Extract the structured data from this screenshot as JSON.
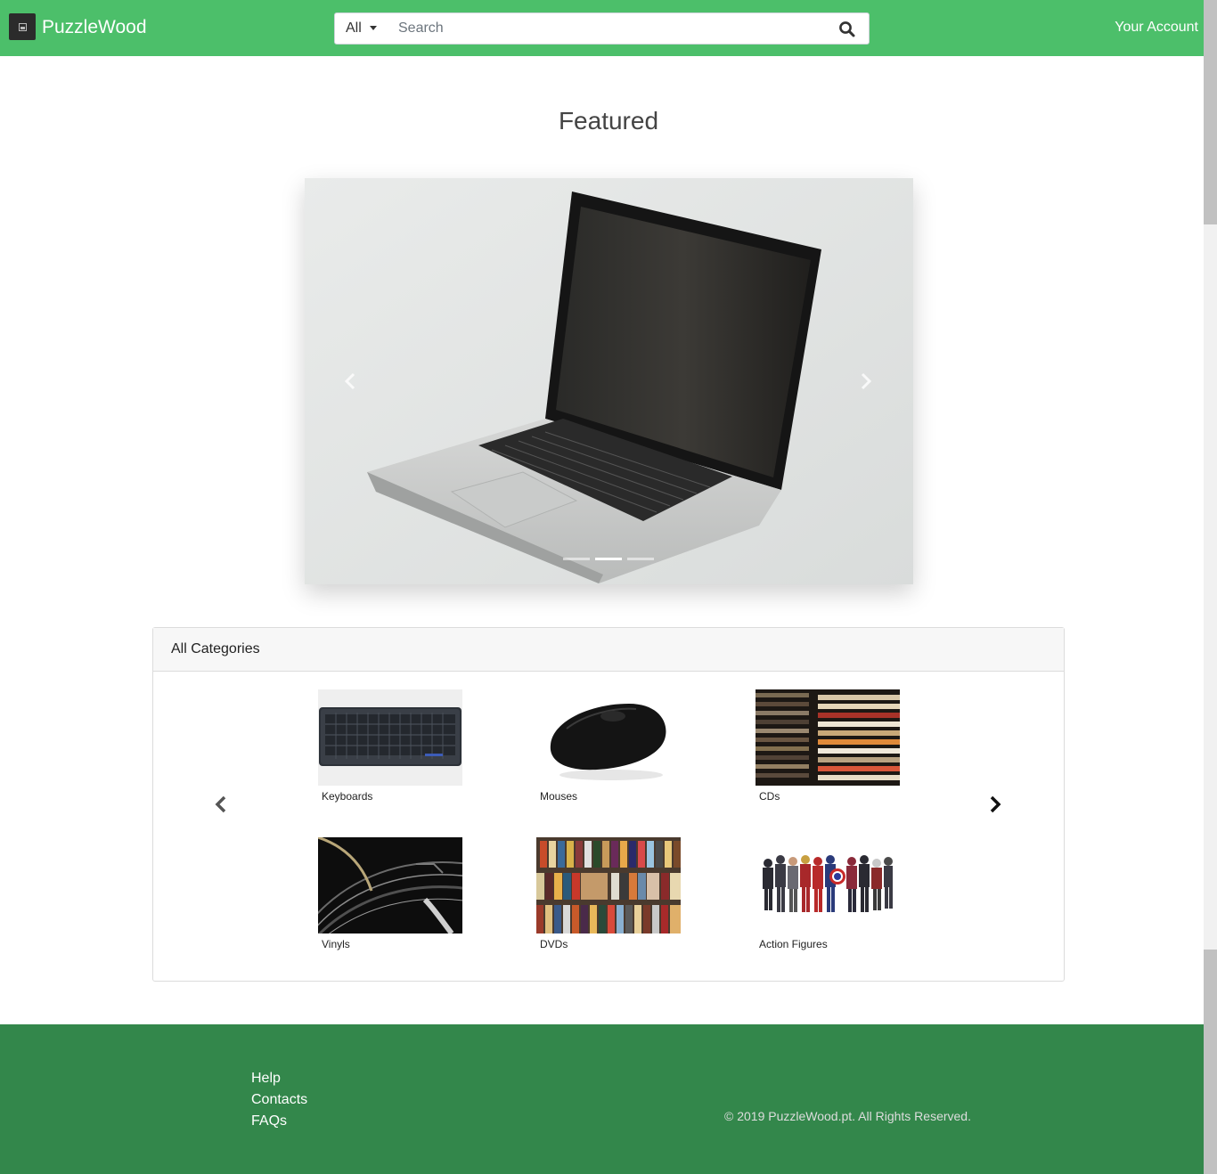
{
  "navbar": {
    "brand": "PuzzleWood",
    "search_category": "All",
    "search_placeholder": "Search",
    "account": "Your Account",
    "bg_color": "#4cbf6a"
  },
  "featured": {
    "title": "Featured",
    "slide_image": "laptop",
    "indicator_count": 3,
    "active_indicator": 2
  },
  "categories": {
    "header": "All Categories",
    "items": [
      {
        "label": "Keyboards",
        "image": "keyboard"
      },
      {
        "label": "Mouses",
        "image": "mouse"
      },
      {
        "label": "CDs",
        "image": "cd-stack"
      },
      {
        "label": "Vinyls",
        "image": "turntable"
      },
      {
        "label": "DVDs",
        "image": "dvd-boxes"
      },
      {
        "label": "Action Figures",
        "image": "action-figures"
      }
    ]
  },
  "footer": {
    "links": [
      "Help",
      "Contacts",
      "FAQs"
    ],
    "copyright": "© 2019 PuzzleWood.pt. All Rights Reserved.",
    "bg_color": "#33874b"
  }
}
